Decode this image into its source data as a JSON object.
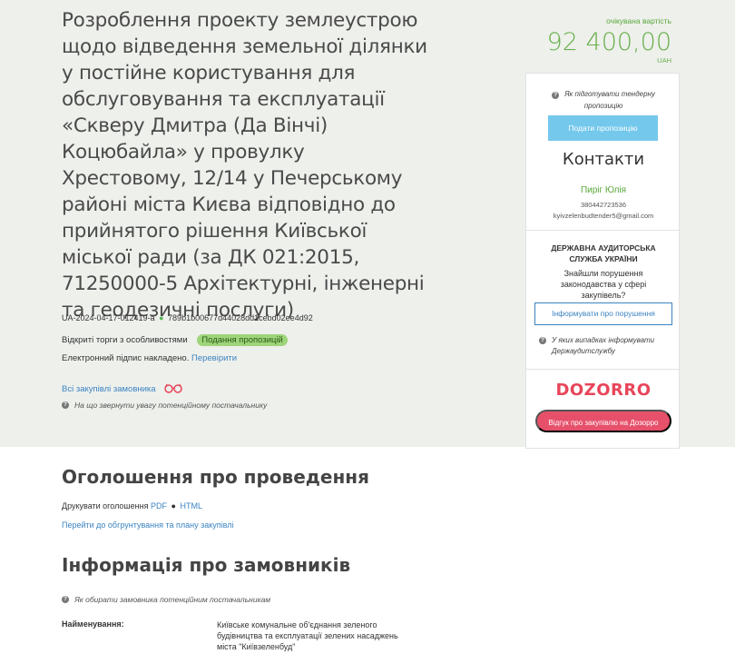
{
  "tender": {
    "title": "Розроблення проекту землеустрою щодо відведення земельної ділянки у постійне користування для обслуговування та експлуатації «Скверу Дмитра (Да Вінчі) Коцюбайла» у провулку Хрестовому, 12/14 у Печерському районі міста Києва відповідно до прийнятого рішення Київської міської ради (за ДК 021:2015, 71250000-5 Архітектурні, інженерні та геодезичні послуги)",
    "id": "UA-2024-04-17-012419-a",
    "hash": "789b1b00677d44028dd1cebd02ee4d92",
    "separator": "●",
    "procedure": "Відкриті торги з особливостями",
    "status": "Подання пропозицій",
    "signature_text": "Електронний підпис накладено.",
    "signature_link": "Перевірити",
    "all_purchases_link": "Всі закупівлі замовника",
    "attention_hint": "На що звернути увагу потенційному постачальнику",
    "help_icon": "?"
  },
  "price": {
    "label": "очікувана вартість",
    "value": "92 400,00",
    "currency": "UAH"
  },
  "sidebar": {
    "how_to_prepare": "Як підготувати тендерну пропозицію",
    "submit_button": "Подати пропозицію",
    "contacts_title": "Контакти",
    "contact_name": "Пиріг Юлія",
    "contact_phone": "380442723536",
    "contact_email": "kyivzelenbudtender5@gmail.com",
    "audit_title": "ДЕРЖАВНА АУДИТОРСЬКА СЛУЖБА УКРАЇНИ",
    "audit_text": "Знайшли порушення законодавства у сфері закупівель?",
    "inform_button": "Інформувати про порушення",
    "when_inform": "У яких випадках інформувати Держаудитслужбу",
    "dozorro_logo": "DOZORRO",
    "dozorro_button": "Відгук про закупівлю на Дозорро"
  },
  "announcement": {
    "title": "Оголошення про проведення",
    "print_label": "Друкувати оголошення",
    "pdf_link": "PDF",
    "html_link": "HTML",
    "plan_link": "Перейти до обгрунтування та плану закупівлі"
  },
  "customers": {
    "title": "Інформація про замовників",
    "choose_hint": "Як обирати замовника потенційним постачальникам",
    "name_label": "Найменування:",
    "name_value": "Київське комунальне об'єднання зеленого будівництва та експлуатації зелених насаджень міста \"Київзеленбуд\""
  },
  "colors": {
    "band": "#eef0ec",
    "accent_green": "#6ab04c",
    "link_blue": "#3b83c0",
    "submit_blue": "#74c8ec",
    "dozorro_red": "#e6506a",
    "status_badge": "#9ed47a"
  }
}
